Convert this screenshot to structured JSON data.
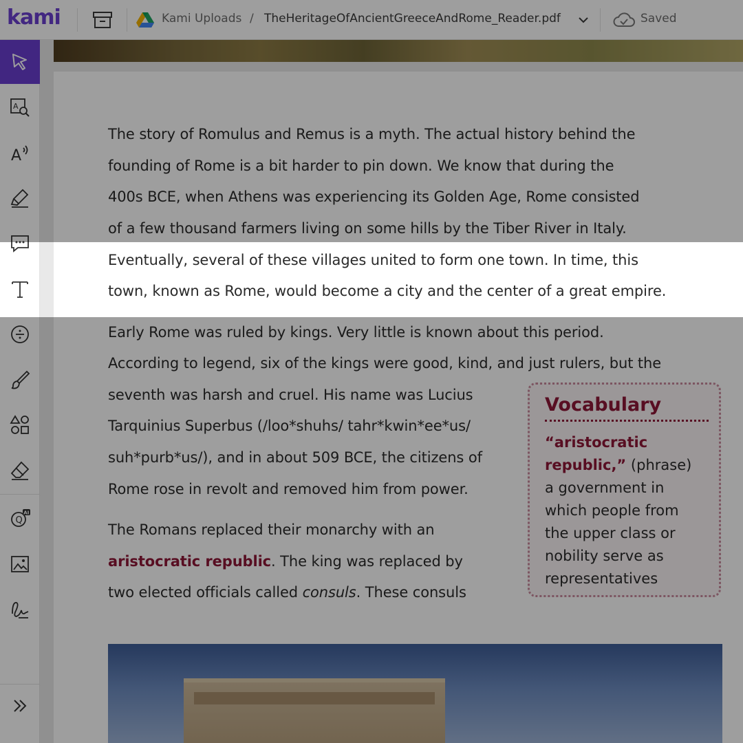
{
  "app": {
    "logo": "kami",
    "breadcrumb_folder": "Kami Uploads",
    "breadcrumb_separator": "/",
    "file_name": "TheHeritageOfAncientGreeceAndRome_Reader.pdf",
    "save_status": "Saved",
    "accent_color": "#6a3ed0"
  },
  "toolbar": {
    "tools": [
      {
        "name": "select",
        "icon": "cursor-icon",
        "active": true
      },
      {
        "name": "dictionary",
        "icon": "dictionary-icon"
      },
      {
        "name": "read-aloud",
        "icon": "read-aloud-icon"
      },
      {
        "name": "markup",
        "icon": "highlighter-icon"
      },
      {
        "name": "comment",
        "icon": "comment-icon"
      },
      {
        "name": "text",
        "icon": "text-icon"
      },
      {
        "name": "equation",
        "icon": "equation-icon"
      },
      {
        "name": "drawing",
        "icon": "brush-icon"
      },
      {
        "name": "shapes",
        "icon": "shapes-icon"
      },
      {
        "name": "eraser",
        "icon": "eraser-icon"
      },
      {
        "name": "add-question",
        "icon": "ai-question-icon",
        "badge": "AI"
      },
      {
        "name": "add-media",
        "icon": "image-icon"
      },
      {
        "name": "signature",
        "icon": "signature-icon"
      },
      {
        "name": "expand",
        "icon": "expand-icon"
      }
    ]
  },
  "document": {
    "para1": [
      "The story of Romulus and Remus is a myth. The actual history behind the",
      "founding of Rome is a bit harder to pin down. We know that during the",
      "400s BCE, when Athens was experiencing its Golden Age, Rome consisted",
      "of a few thousand farmers living on some hills by the Tiber River in Italy.",
      "Eventually, several of these villages united to form one town. In time, this",
      "town, known as Rome, would become a city and the center of a great empire."
    ],
    "para2": [
      "Early Rome was ruled by kings. Very little is known about this period.",
      "According to legend, six of the kings were good, kind, and just rulers, but the",
      "seventh was harsh and cruel. His name was Lucius",
      "Tarquinius Superbus (/loo*shuhs/ tahr*kwin*ee*us/",
      "suh*purb*us/), and in about 509 BCE, the citizens of",
      "Rome rose in revolt and removed him from power."
    ],
    "para3": {
      "line1": "The Romans replaced their monarchy with an",
      "term": "aristocratic republic",
      "line2_rest": ". The king was replaced by",
      "line3_a": "two elected officials called ",
      "line3_em": "consuls",
      "line3_b": ". These consuls"
    },
    "vocabulary": {
      "title": "Vocabulary",
      "term_line1": "“aristocratic",
      "term_line2": "republic,”",
      "part_of_speech": " (phrase)",
      "definition_lines": [
        "a government in",
        "which people from",
        "the upper class or",
        "nobility serve as",
        "representatives"
      ],
      "accent_color": "#8e1838"
    }
  }
}
